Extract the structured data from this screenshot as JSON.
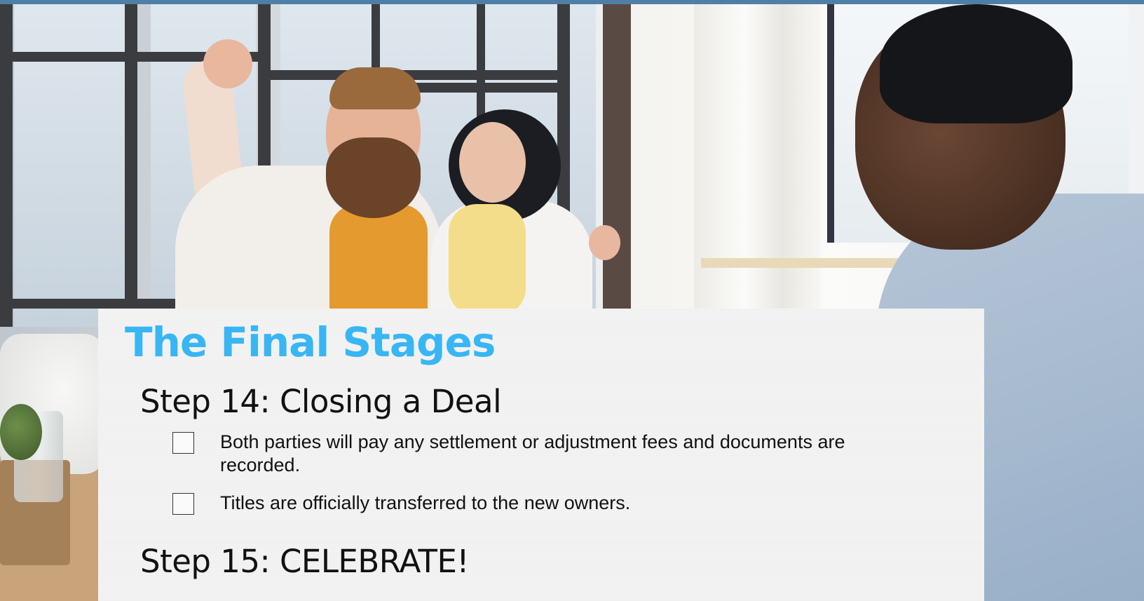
{
  "slide": {
    "title": "The Final Stages",
    "accent_color": "#38b6f3",
    "top_bar_color": "#4f7fa7",
    "background_image": "photo of a cheering couple with a real estate agent in a bright home",
    "steps": [
      {
        "heading": "Step 14: Closing a Deal",
        "items": [
          {
            "text": "Both parties will pay any settlement or adjustment fees and documents are recorded.",
            "checked": false
          },
          {
            "text": "Titles are officially transferred to the new owners.",
            "checked": false
          }
        ]
      },
      {
        "heading": "Step 15: CELEBRATE!",
        "items": []
      }
    ]
  }
}
